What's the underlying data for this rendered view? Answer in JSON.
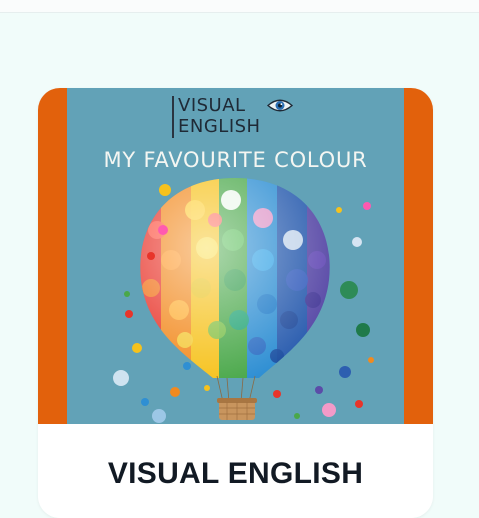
{
  "card": {
    "logo": {
      "line1": "VISUAL",
      "line2": "ENGLISH",
      "icon": "eye-icon"
    },
    "poster_title": "MY FAVOURITE COLOUR",
    "title": "VISUAL ENGLISH"
  },
  "colors": {
    "page_background": "#f1fcfa",
    "card_border_accent": "#e2610c",
    "poster_background": "#62a2b7",
    "title_text": "#121a24"
  }
}
